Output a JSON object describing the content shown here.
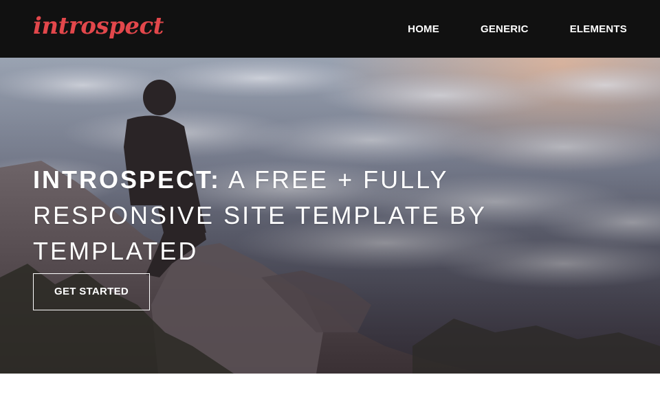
{
  "header": {
    "logo": "introspect",
    "nav": [
      {
        "label": "HOME"
      },
      {
        "label": "GENERIC"
      },
      {
        "label": "ELEMENTS"
      }
    ]
  },
  "banner": {
    "title_strong": "INTROSPECT:",
    "title_rest": " A FREE + FULLY RESPONSIVE SITE TEMPLATE BY TEMPLATED",
    "button_label": "GET STARTED"
  },
  "colors": {
    "header_bg": "#111111",
    "logo": "#e2474b",
    "text": "#ffffff"
  }
}
